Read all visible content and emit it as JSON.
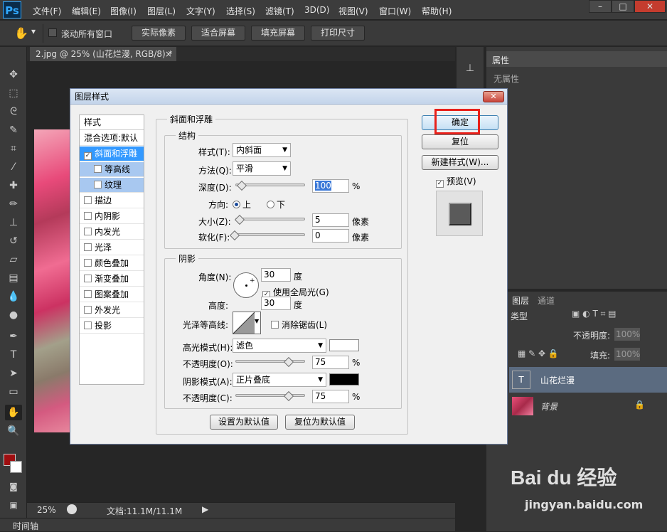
{
  "app": {
    "logo": "Ps"
  },
  "menu": [
    "文件(F)",
    "编辑(E)",
    "图像(I)",
    "图层(L)",
    "文字(Y)",
    "选择(S)",
    "滤镜(T)",
    "3D(D)",
    "视图(V)",
    "窗口(W)",
    "帮助(H)"
  ],
  "window_controls": {
    "minimize": "–",
    "restore": "□",
    "close": "✕"
  },
  "options": {
    "scroll_all_label": "滚动所有窗口",
    "actual_pixels": "实际像素",
    "fit_screen": "适合屏幕",
    "fill_screen": "填充屏幕",
    "print_size": "打印尺寸"
  },
  "document": {
    "tab_title": "2.jpg @ 25% (山花烂漫, RGB/8) *",
    "tab_close": "×"
  },
  "status": {
    "zoom": "25%",
    "doc_info": "文档:11.1M/11.1M"
  },
  "timeline": {
    "label": "时间轴"
  },
  "properties": {
    "title": "属性",
    "empty_text": "无属性"
  },
  "layers": {
    "tab_layers": "图层",
    "tab_channels": "通道",
    "kind_label": "类型",
    "opacity_label": "不透明度:",
    "opacity_value": "100%",
    "fill_label": "填充:",
    "fill_value": "100%",
    "items": [
      {
        "name": "山花烂漫",
        "selected": true
      },
      {
        "name": "背景",
        "selected": false
      }
    ]
  },
  "dialog": {
    "title": "图层样式",
    "close": "✕",
    "styles_header": "样式",
    "blend_options": "混合选项:默认",
    "style_list": [
      {
        "label": "斜面和浮雕",
        "checked": true,
        "active": true,
        "indent": false
      },
      {
        "label": "等高线",
        "checked": false,
        "active": false,
        "indent": true
      },
      {
        "label": "纹理",
        "checked": false,
        "active": false,
        "indent": true
      },
      {
        "label": "描边",
        "checked": false,
        "active": false,
        "indent": false
      },
      {
        "label": "内阴影",
        "checked": false,
        "active": false,
        "indent": false
      },
      {
        "label": "内发光",
        "checked": false,
        "active": false,
        "indent": false
      },
      {
        "label": "光泽",
        "checked": false,
        "active": false,
        "indent": false
      },
      {
        "label": "颜色叠加",
        "checked": false,
        "active": false,
        "indent": false
      },
      {
        "label": "渐变叠加",
        "checked": false,
        "active": false,
        "indent": false
      },
      {
        "label": "图案叠加",
        "checked": false,
        "active": false,
        "indent": false
      },
      {
        "label": "外发光",
        "checked": false,
        "active": false,
        "indent": false
      },
      {
        "label": "投影",
        "checked": false,
        "active": false,
        "indent": false
      }
    ],
    "bevel": {
      "group_title": "斜面和浮雕",
      "structure_title": "结构",
      "style_label": "样式(T):",
      "style_value": "内斜面",
      "technique_label": "方法(Q):",
      "technique_value": "平滑",
      "depth_label": "深度(D):",
      "depth_value": "100",
      "depth_unit": "%",
      "direction_label": "方向:",
      "direction_up": "上",
      "direction_down": "下",
      "size_label": "大小(Z):",
      "size_value": "5",
      "size_unit": "像素",
      "soften_label": "软化(F):",
      "soften_value": "0",
      "soften_unit": "像素"
    },
    "shading": {
      "title": "阴影",
      "angle_label": "角度(N):",
      "angle_value": "30",
      "angle_unit": "度",
      "global_light_label": "使用全局光(G)",
      "altitude_label": "高度:",
      "altitude_value": "30",
      "altitude_unit": "度",
      "gloss_contour_label": "光泽等高线:",
      "anti_alias_label": "消除锯齿(L)",
      "highlight_mode_label": "高光模式(H):",
      "highlight_mode_value": "滤色",
      "highlight_color": "#ffffff",
      "highlight_opacity_label": "不透明度(O):",
      "highlight_opacity_value": "75",
      "shadow_mode_label": "阴影模式(A):",
      "shadow_mode_value": "正片叠底",
      "shadow_color": "#000000",
      "shadow_opacity_label": "不透明度(C):",
      "shadow_opacity_value": "75",
      "percent": "%"
    },
    "make_default": "设置为默认值",
    "reset_default": "复位为默认值",
    "ok": "确定",
    "reset": "复位",
    "new_style": "新建样式(W)...",
    "preview_label": "预览(V)"
  },
  "watermark": {
    "brand": "Bai du 经验",
    "url": "jingyan.baidu.com"
  }
}
